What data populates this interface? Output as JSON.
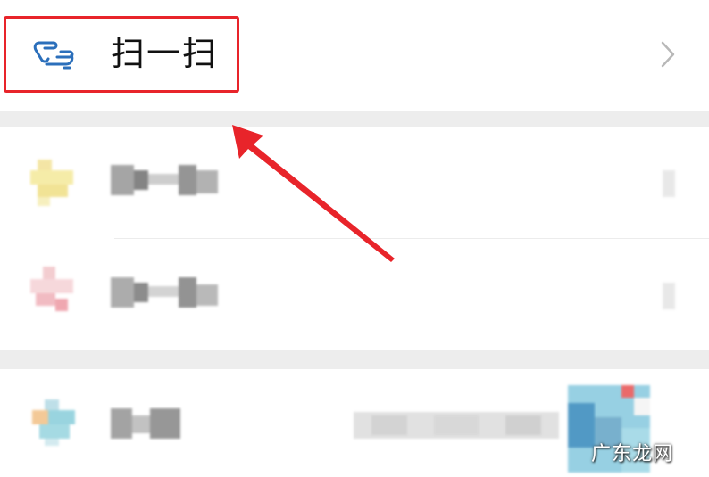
{
  "scan_row": {
    "label": "扫一扫",
    "icon": "scan-icon",
    "chevron_icon": "chevron-right-icon",
    "accent_color": "#2b6fbb"
  },
  "annotation": {
    "box_color": "#e8242a",
    "arrow_color": "#e8242a"
  },
  "watermark": {
    "text": "广东龙网"
  }
}
